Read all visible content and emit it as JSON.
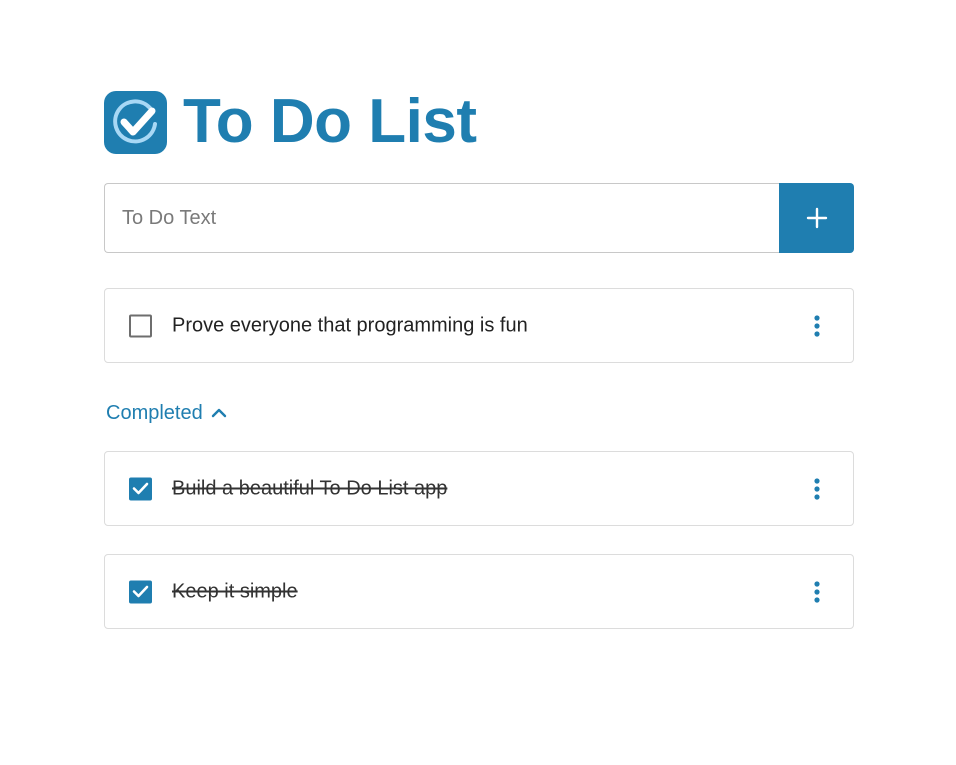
{
  "header": {
    "title": "To Do List",
    "logo_icon": "checkmark-circle-icon"
  },
  "add_form": {
    "placeholder": "To Do Text",
    "value": "",
    "add_button_icon": "plus-icon"
  },
  "pending": [
    {
      "text": "Prove everyone that programming is fun",
      "checked": false
    }
  ],
  "completed_section": {
    "label": "Completed",
    "expanded": true,
    "toggle_icon": "chevron-up-icon"
  },
  "completed": [
    {
      "text": "Build a beautiful To Do List app",
      "checked": true
    },
    {
      "text": "Keep it simple",
      "checked": true
    }
  ],
  "colors": {
    "accent": "#1f7eb0",
    "border": "#dcdcdc",
    "text": "#222222"
  }
}
